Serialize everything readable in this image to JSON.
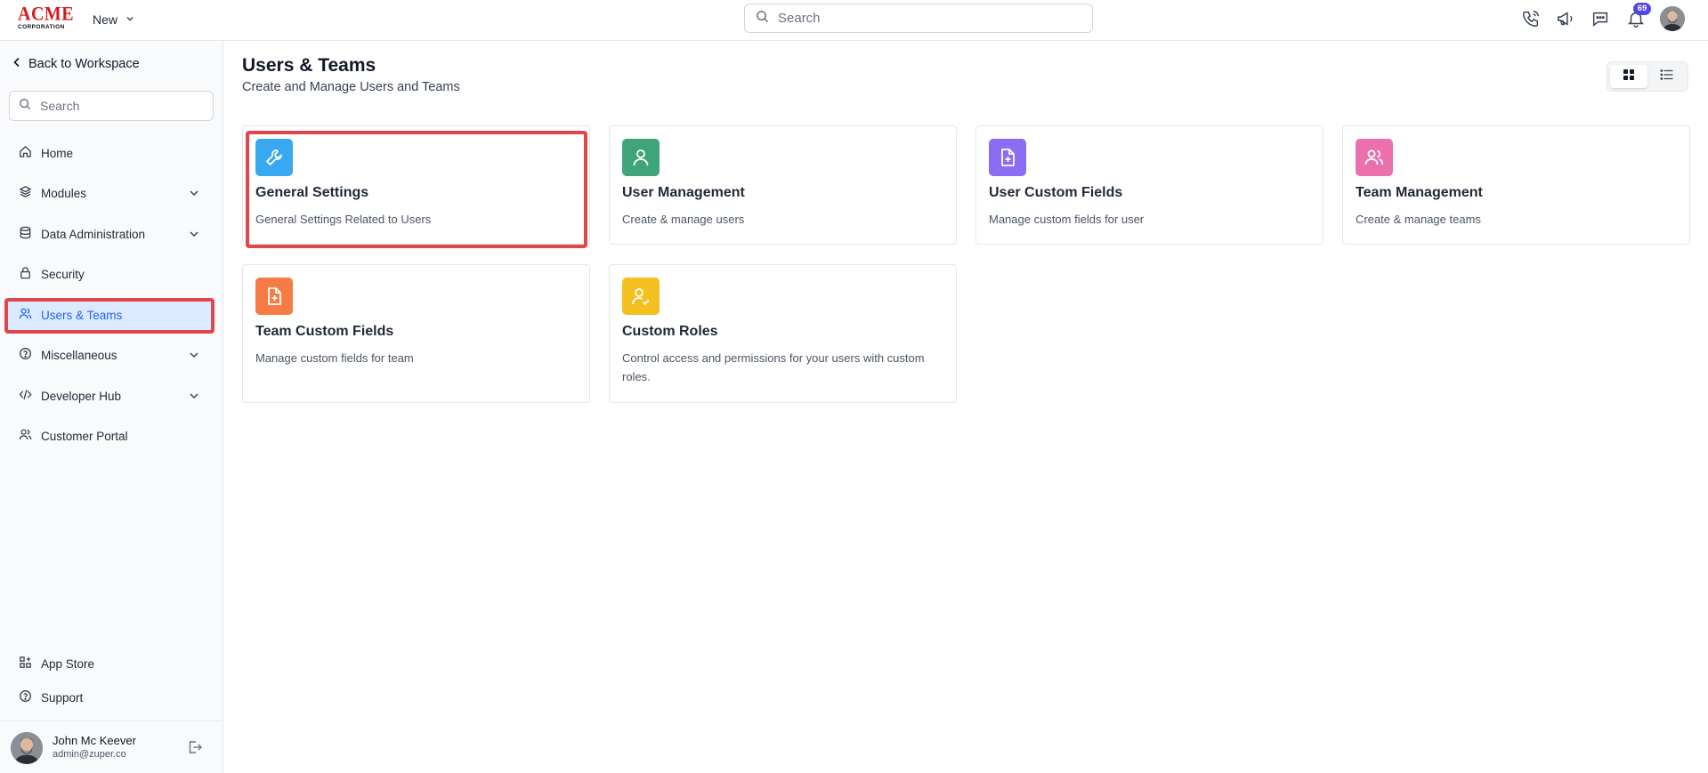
{
  "header": {
    "logo_line1": "ACME",
    "logo_line2": "CORPORATION",
    "new_label": "New",
    "search_placeholder": "Search",
    "notification_count": "69",
    "icons": [
      "phone-icon",
      "megaphone-icon",
      "chat-icon",
      "bell-icon",
      "avatar"
    ]
  },
  "sidebar": {
    "back_label": "Back to Workspace",
    "search_placeholder": "Search",
    "items": [
      {
        "label": "Home",
        "icon": "home-icon",
        "expandable": false
      },
      {
        "label": "Modules",
        "icon": "layers-icon",
        "expandable": true
      },
      {
        "label": "Data Administration",
        "icon": "database-icon",
        "expandable": true
      },
      {
        "label": "Security",
        "icon": "lock-icon",
        "expandable": false
      },
      {
        "label": "Users & Teams",
        "icon": "users-icon",
        "expandable": false,
        "active": true
      },
      {
        "label": "Miscellaneous",
        "icon": "help-circle-icon",
        "expandable": true
      },
      {
        "label": "Developer Hub",
        "icon": "code-icon",
        "expandable": true
      },
      {
        "label": "Customer Portal",
        "icon": "users-icon",
        "expandable": false
      }
    ],
    "bottom_items": [
      {
        "label": "App Store",
        "icon": "apps-icon"
      },
      {
        "label": "Support",
        "icon": "help-circle-icon"
      }
    ],
    "user": {
      "name": "John Mc Keever",
      "email": "admin@zuper.co"
    }
  },
  "main": {
    "title": "Users & Teams",
    "subtitle": "Create and Manage Users and Teams",
    "view_mode": "grid",
    "cards": [
      {
        "title": "General Settings",
        "description": "General Settings Related to Users",
        "icon": "wrench-icon",
        "color": "#38a8f0"
      },
      {
        "title": "User Management",
        "description": "Create & manage users",
        "icon": "user-icon",
        "color": "#3fa47a"
      },
      {
        "title": "User Custom Fields",
        "description": "Manage custom fields for user",
        "icon": "file-plus-icon",
        "color": "#8b6cf2"
      },
      {
        "title": "Team Management",
        "description": "Create & manage teams",
        "icon": "users-icon",
        "color": "#ec6fae"
      },
      {
        "title": "Team Custom Fields",
        "description": "Manage custom fields for team",
        "icon": "file-plus-icon",
        "color": "#f77b45"
      },
      {
        "title": "Custom Roles",
        "description": "Control access and permissions for your users with custom roles.",
        "icon": "user-check-icon",
        "color": "#f4bf20"
      }
    ]
  },
  "colors": {
    "accent": "#2563eb",
    "highlight": "#e0464a",
    "badge": "#4f46e5"
  }
}
